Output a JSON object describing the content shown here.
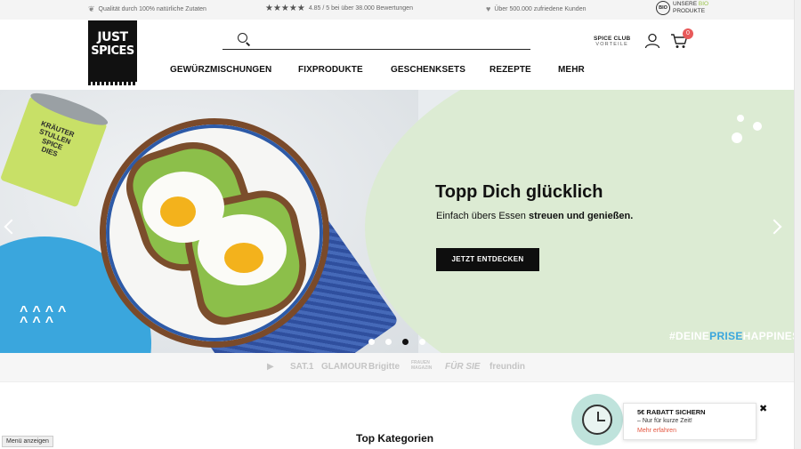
{
  "topbar": {
    "quality": "Qualität durch 100% natürliche Zutaten",
    "rating": "4.85 / 5 bei über 38.000 Bewertungen",
    "customers": "Über 500.000 zufriedene Kunden",
    "bio_badge": "BIO",
    "bio_line1": "UNSERE",
    "bio_line1_green": "BIO",
    "bio_line2": "PRODUKTE"
  },
  "logo": {
    "line1": "JUST",
    "line2": "SPICES"
  },
  "search": {
    "value": "",
    "placeholder": ""
  },
  "header": {
    "spice_club_line1": "SPICE CLUB",
    "spice_club_line2": "VORTEILE",
    "cart_count": "0"
  },
  "nav": {
    "items": [
      {
        "label": "GEWÜRZMISCHUNGEN"
      },
      {
        "label": "FIXPRODUKTE"
      },
      {
        "label": "GESCHENKSETS"
      },
      {
        "label": "REZEPTE"
      },
      {
        "label": "MEHR"
      }
    ]
  },
  "hero": {
    "title": "Topp Dich glücklich",
    "subtitle_plain": "Einfach übers Essen ",
    "subtitle_bold": "streuen und genießen.",
    "button": "JETZT ENTDECKEN",
    "can_label_1": "KRÄUTER",
    "can_label_2": "STULLEN",
    "can_label_3": "SPICE",
    "can_label_4": "DIES",
    "hashtag_part1": "#DEINE",
    "hashtag_part2": "PRISE",
    "hashtag_part3": "HAPPINESS",
    "slide_count": 4,
    "active_slide": 3
  },
  "press": {
    "logos": [
      "SAT.1",
      "GLAMOUR",
      "Brigitte",
      "FRAUEN MAGAZIN",
      "FÜR SIE",
      "freundin"
    ]
  },
  "sections": {
    "top_categories": "Top Kategorien"
  },
  "menu_toggle": "Menü anzeigen",
  "promo": {
    "title": "5€ RABATT SICHERN",
    "subtitle": "– Nur für kurze Zeit!",
    "link": "Mehr erfahren",
    "close": "✖"
  },
  "colors": {
    "accent_green": "#dcebd3",
    "hero_blue": "#3aa6dd",
    "badge_red": "#e85a5a",
    "link_red": "#e4553f",
    "button_black": "#0e0e0e"
  },
  "icons": [
    "leaf-icon",
    "star-icon",
    "heart-icon",
    "search-icon",
    "user-icon",
    "cart-icon",
    "arrow-left-icon",
    "arrow-right-icon",
    "clock-icon",
    "close-icon"
  ]
}
